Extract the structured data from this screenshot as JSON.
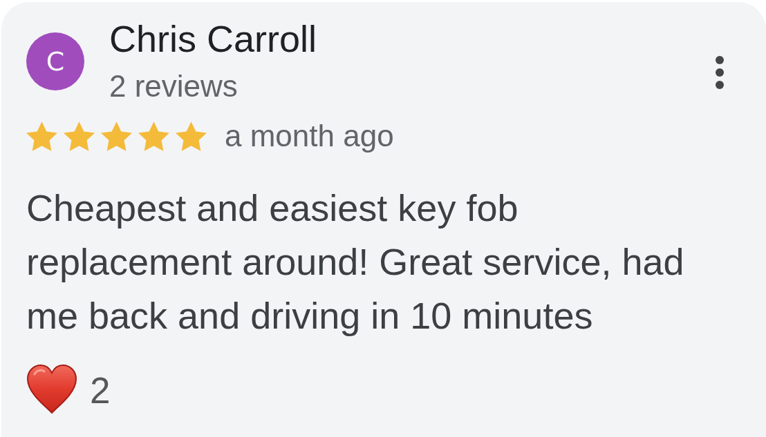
{
  "review": {
    "author": {
      "avatar_initial": "C",
      "name": "Chris Carroll",
      "review_count": "2 reviews"
    },
    "stars": 5,
    "time": "a month ago",
    "text": "Cheapest and easiest key fob replacement around! Great service, had me back and driving in 10 minutes",
    "reaction": {
      "count": "2"
    }
  }
}
